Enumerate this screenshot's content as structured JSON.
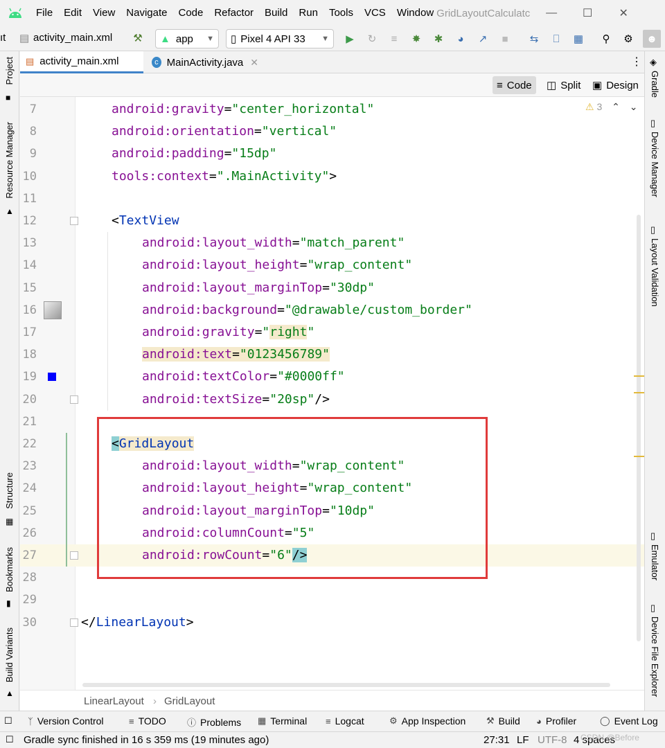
{
  "menu": {
    "items": [
      "File",
      "Edit",
      "View",
      "Navigate",
      "Code",
      "Refactor",
      "Build",
      "Run",
      "Tools",
      "VCS",
      "Window"
    ],
    "window_title": "GridLayoutCalculatc"
  },
  "toolbar": {
    "crumb_prefix": "ıt",
    "file": "activity_main.xml",
    "run_config": "app",
    "device": "Pixel 4 API 33"
  },
  "tabs": [
    {
      "label": "activity_main.xml",
      "active": true
    },
    {
      "label": "MainActivity.java",
      "active": false
    }
  ],
  "view_modes": {
    "code": "Code",
    "split": "Split",
    "design": "Design"
  },
  "inspection": {
    "warnings": "3"
  },
  "left_strip": {
    "project": "Project",
    "resource_manager": "Resource Manager",
    "structure": "Structure",
    "bookmarks": "Bookmarks",
    "build_variants": "Build Variants"
  },
  "right_strip": {
    "gradle": "Gradle",
    "device_manager": "Device Manager",
    "layout_validation": "Layout Validation",
    "emulator": "Emulator",
    "device_file_explorer": "Device File Explorer"
  },
  "code_lines": [
    {
      "n": "7",
      "indent": "    ",
      "attr_ns": "android",
      "attr": "gravity",
      "value": "\"center_horizontal\""
    },
    {
      "n": "8",
      "indent": "    ",
      "attr_ns": "android",
      "attr": "orientation",
      "value": "\"vertical\""
    },
    {
      "n": "9",
      "indent": "    ",
      "attr_ns": "android",
      "attr": "padding",
      "value": "\"15dp\""
    },
    {
      "n": "10",
      "indent": "    ",
      "attr_ns": "tools",
      "attr": "context",
      "value": "\".MainActivity\"",
      "close": ">"
    },
    {
      "n": "11"
    },
    {
      "n": "12",
      "tag_open": "<",
      "tag": "TextView"
    },
    {
      "n": "13",
      "indent": "        ",
      "attr_ns": "android",
      "attr": "layout_width",
      "value": "\"match_parent\""
    },
    {
      "n": "14",
      "indent": "        ",
      "attr_ns": "android",
      "attr": "layout_height",
      "value": "\"wrap_content\""
    },
    {
      "n": "15",
      "indent": "        ",
      "attr_ns": "android",
      "attr": "layout_marginTop",
      "value": "\"30dp\""
    },
    {
      "n": "16",
      "indent": "        ",
      "attr_ns": "android",
      "attr": "background",
      "value": "\"@drawable/custom_border\""
    },
    {
      "n": "17",
      "indent": "        ",
      "attr_ns": "android",
      "attr": "gravity",
      "value": "\"right\""
    },
    {
      "n": "18",
      "indent": "        ",
      "attr_ns": "android",
      "attr": "text",
      "value": "\"0123456789\""
    },
    {
      "n": "19",
      "indent": "        ",
      "attr_ns": "android",
      "attr": "textColor",
      "value": "\"#0000ff\""
    },
    {
      "n": "20",
      "indent": "        ",
      "attr_ns": "android",
      "attr": "textSize",
      "value": "\"20sp\"",
      "close": "/>"
    },
    {
      "n": "21"
    },
    {
      "n": "22",
      "tag_open": "<",
      "tag": "GridLayout"
    },
    {
      "n": "23",
      "indent": "        ",
      "attr_ns": "android",
      "attr": "layout_width",
      "value": "\"wrap_content\""
    },
    {
      "n": "24",
      "indent": "        ",
      "attr_ns": "android",
      "attr": "layout_height",
      "value": "\"wrap_content\""
    },
    {
      "n": "25",
      "indent": "        ",
      "attr_ns": "android",
      "attr": "layout_marginTop",
      "value": "\"10dp\""
    },
    {
      "n": "26",
      "indent": "        ",
      "attr_ns": "android",
      "attr": "columnCount",
      "value": "\"5\""
    },
    {
      "n": "27",
      "indent": "        ",
      "attr_ns": "android",
      "attr": "rowCount",
      "value": "\"6\"",
      "close": "/>"
    },
    {
      "n": "28"
    },
    {
      "n": "29"
    },
    {
      "n": "30",
      "closing_tag": "LinearLayout"
    }
  ],
  "breadcrumb": [
    "LinearLayout",
    "GridLayout"
  ],
  "bottom_tools": [
    "Version Control",
    "TODO",
    "Problems",
    "Terminal",
    "Logcat",
    "App Inspection",
    "Build",
    "Profiler",
    "Event Log"
  ],
  "status": {
    "message": "Gradle sync finished in 16 s 359 ms (19 minutes ago)",
    "position": "27:31",
    "line_sep": "LF",
    "encoding": "UTF-8",
    "indent": "4 spaces",
    "watermark": "CSDN @Before"
  },
  "colors": {
    "accent": "#4083c9",
    "highlight_box": "#e03b3b",
    "swatch": "#0000ff"
  }
}
